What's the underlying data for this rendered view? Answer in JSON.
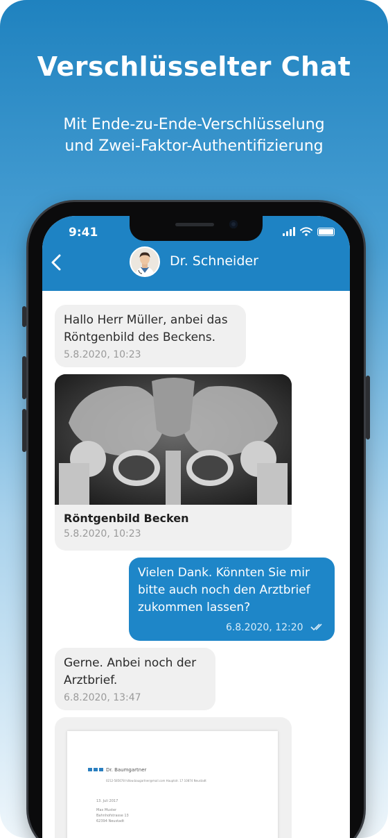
{
  "promo": {
    "headline": "Verschlüsselter Chat",
    "sub_line1": "Mit Ende-zu-Ende-Verschlüsselung",
    "sub_line2": "und Zwei-Faktor-Authentifizierung"
  },
  "status_bar": {
    "time": "9:41"
  },
  "header": {
    "contact_name": "Dr. Schneider"
  },
  "messages": [
    {
      "direction": "in",
      "text_line1": "Hallo Herr Müller, anbei das",
      "text_line2": "Röntgenbild des Beckens.",
      "timestamp": "5.8.2020, 10:23"
    },
    {
      "direction": "in",
      "attachment_title": "Röntgenbild Becken",
      "timestamp": "5.8.2020, 10:23"
    },
    {
      "direction": "out",
      "text_line1": "Vielen Dank. Könnten Sie mir",
      "text_line2": "bitte auch noch den Arztbrief",
      "text_line3": "zukommen lassen?",
      "timestamp": "6.8.2020, 12:20"
    },
    {
      "direction": "in",
      "text_line1": "Gerne. Anbei noch der",
      "text_line2": "Arztbrief.",
      "timestamp": "6.8.2020, 13:47"
    }
  ],
  "document_preview": {
    "sender": "Dr. Baumgartner",
    "contact_line": "0212-585678     hillow.baugartner@mail.com     Hauptstr. 17     10874 Neustadt",
    "date": "13. Juli 2017",
    "recipient_name": "Max Muster",
    "recipient_street": "Bahnhofstrasse 13",
    "recipient_city": "62394 Neustadt"
  },
  "colors": {
    "accent": "#1e83c4",
    "bubble_in": "#f0f0f0",
    "bubble_out": "#1e86c8"
  }
}
